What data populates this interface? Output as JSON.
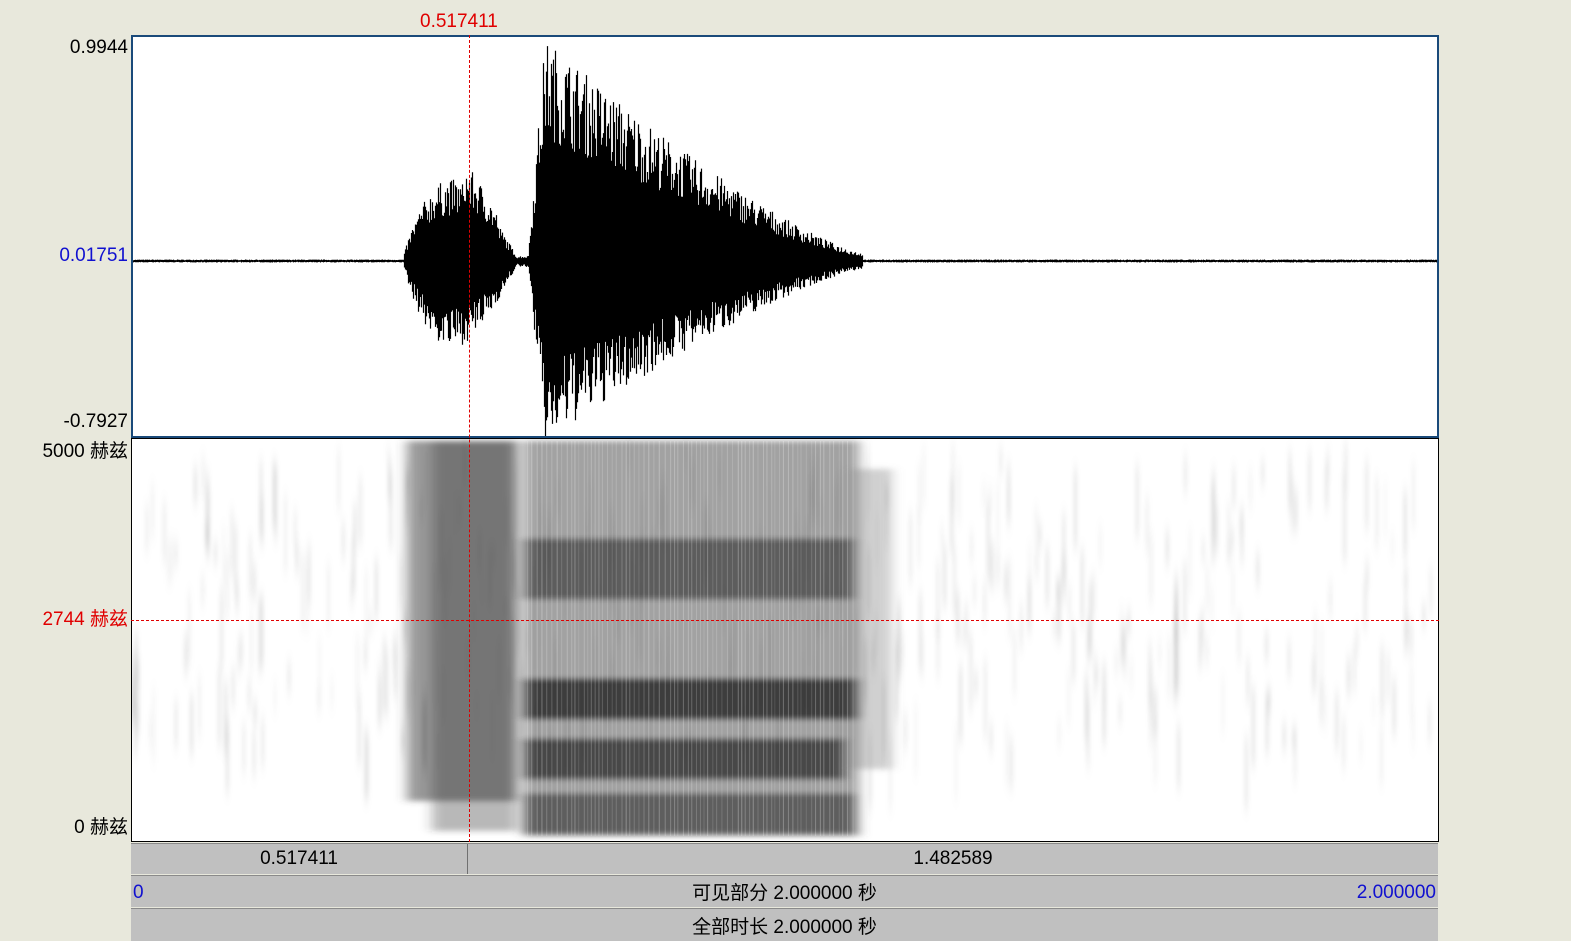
{
  "cursor": {
    "time_label": "0.517411",
    "freq_label": "2744 赫兹",
    "color": "#e00000"
  },
  "waveform": {
    "max_label": "0.9944",
    "zero_label": "0.01751",
    "min_label": "-0.7927"
  },
  "spectrogram": {
    "max_label": "5000 赫兹",
    "min_label": "0 赫兹"
  },
  "selection_bar": {
    "left_value": "0.517411",
    "right_value": "1.482589"
  },
  "visible_bar": {
    "start": "0",
    "label": "可见部分 2.000000 秒",
    "end": "2.000000"
  },
  "total_bar": {
    "label": "全部时长 2.000000 秒"
  },
  "colors": {
    "accent_blue": "#1010d0",
    "cursor_red": "#e00000",
    "bar_gray": "#c0c0c0"
  }
}
